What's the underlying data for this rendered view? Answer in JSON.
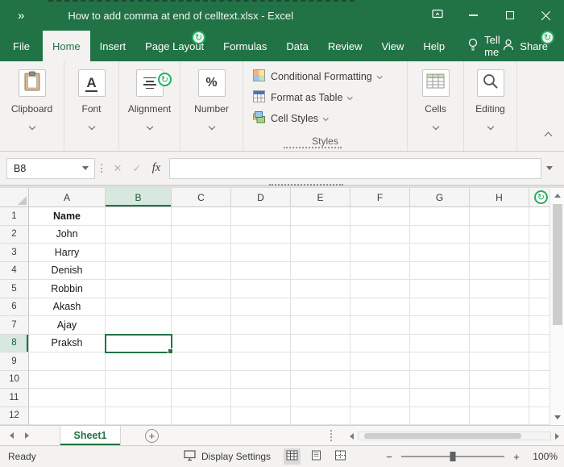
{
  "window": {
    "quick_access": "»",
    "title": "How to add comma at end of celltext.xlsx - Excel"
  },
  "menu": {
    "file": "File",
    "tabs": [
      "Home",
      "Insert",
      "Page Layout",
      "Formulas",
      "Data",
      "Review",
      "View",
      "Help"
    ],
    "active_tab": "Home",
    "tell_me": "Tell me",
    "share": "Share"
  },
  "ribbon": {
    "clipboard": "Clipboard",
    "font": "Font",
    "font_icon": "A",
    "alignment": "Alignment",
    "number": "Number",
    "number_icon": "%",
    "conditional_formatting": "Conditional Formatting",
    "format_as_table": "Format as Table",
    "cell_styles": "Cell Styles",
    "styles": "Styles",
    "cells": "Cells",
    "editing": "Editing"
  },
  "formula_bar": {
    "name_box": "B8",
    "cancel": "✕",
    "enter": "✓",
    "fx": "fx",
    "formula": ""
  },
  "grid": {
    "column_headers": [
      "A",
      "B",
      "C",
      "D",
      "E",
      "F",
      "G",
      "H"
    ],
    "row_headers": [
      "1",
      "2",
      "3",
      "4",
      "5",
      "6",
      "7",
      "8",
      "9",
      "10",
      "11",
      "12"
    ],
    "column_a_values": [
      "Name",
      "John",
      "Harry",
      "Denish",
      "Robbin",
      "Akash",
      "Ajay",
      "Praksh"
    ],
    "active_cell": "B8"
  },
  "sheet_bar": {
    "sheet_tab": "Sheet1",
    "add_sheet": "+"
  },
  "status_bar": {
    "mode": "Ready",
    "display_settings": "Display Settings",
    "zoom_out": "−",
    "zoom_in": "+",
    "zoom_level": "100%"
  },
  "colors": {
    "excel_green": "#217346"
  }
}
